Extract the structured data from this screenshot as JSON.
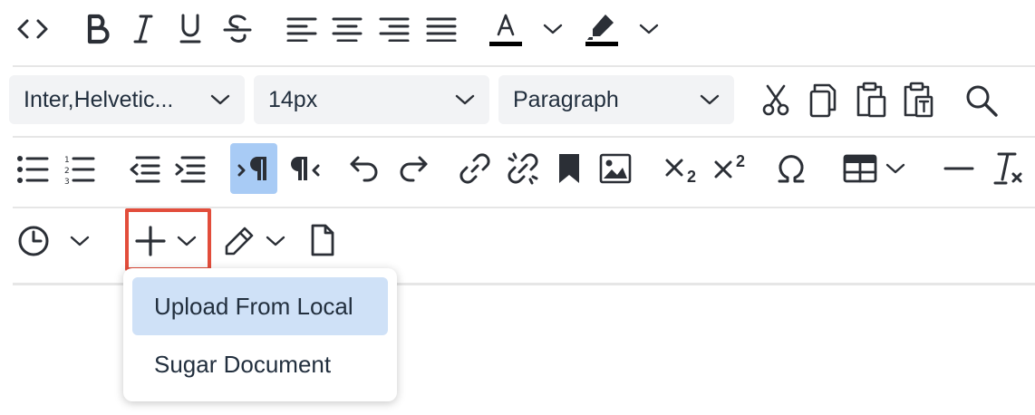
{
  "toolbar": {
    "row2": {
      "font_family": {
        "value": "Inter,Helvetic..."
      },
      "font_size": {
        "value": "14px"
      },
      "block_format": {
        "value": "Paragraph"
      }
    },
    "row3": {
      "subscript_digit": "2",
      "superscript_digit": "2"
    },
    "row4": {
      "insert_highlight_color": "#e24d3b"
    }
  },
  "insert_menu": {
    "items": [
      {
        "label": "Upload From Local",
        "selected": true
      },
      {
        "label": "Sugar Document",
        "selected": false
      }
    ]
  },
  "colors": {
    "icon": "#2b2f36",
    "active_button": "#a8cbf5",
    "menu_selected": "#cfe1f7",
    "select_bg": "#f2f3f5",
    "highlight_box": "#e24d3b"
  },
  "icons": [
    "source-code-icon",
    "bold-icon",
    "italic-icon",
    "underline-icon",
    "strikethrough-icon",
    "align-left-icon",
    "align-center-icon",
    "align-right-icon",
    "align-justify-icon",
    "text-color-icon",
    "highlight-color-icon",
    "cut-icon",
    "copy-icon",
    "paste-icon",
    "paste-text-icon",
    "search-icon",
    "bullet-list-icon",
    "numbered-list-icon",
    "outdent-icon",
    "indent-icon",
    "ltr-icon",
    "rtl-icon",
    "undo-icon",
    "redo-icon",
    "link-icon",
    "unlink-icon",
    "bookmark-icon",
    "image-icon",
    "subscript-icon",
    "superscript-icon",
    "omega-icon",
    "table-icon",
    "hr-icon",
    "clear-format-icon",
    "clock-icon",
    "plus-icon",
    "pencil-icon",
    "document-icon",
    "chevron-down-icon"
  ]
}
